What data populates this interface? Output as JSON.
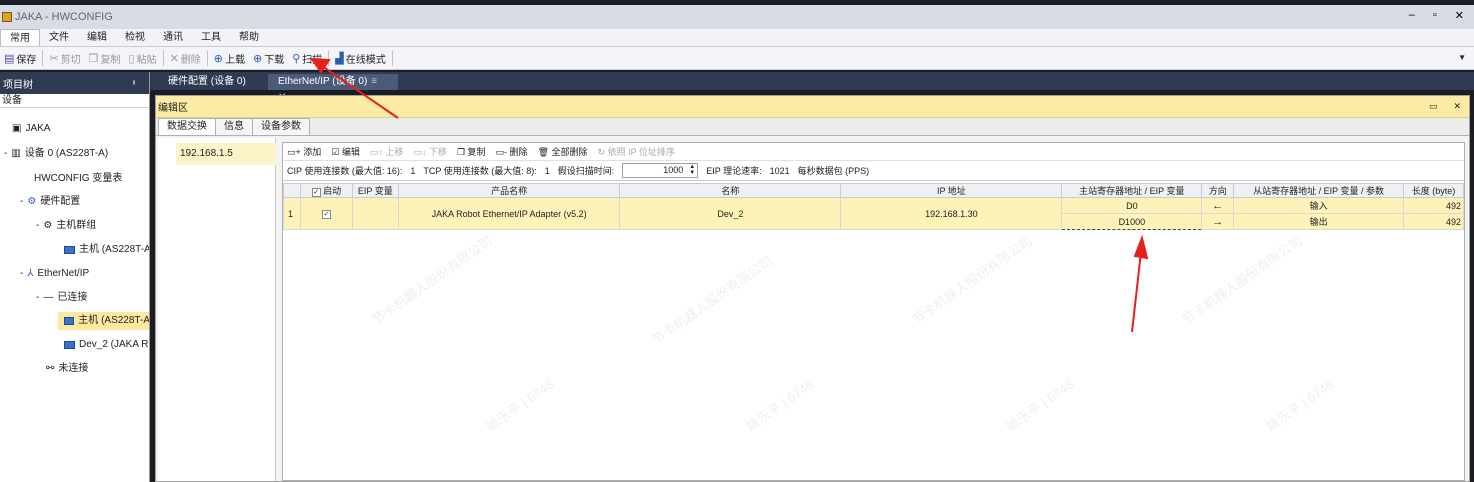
{
  "window": {
    "title": "JAKA - HWCONFIG",
    "minimize": "‒",
    "restore": "▫",
    "close": "✕"
  },
  "menu": {
    "items": [
      {
        "label": "常用"
      },
      {
        "label": "文件"
      },
      {
        "label": "编辑"
      },
      {
        "label": "检视"
      },
      {
        "label": "通讯"
      },
      {
        "label": "工具"
      },
      {
        "label": "帮助"
      }
    ]
  },
  "toolbar": {
    "save": "保存",
    "cut": "剪切",
    "copy": "复制",
    "paste": "粘贴",
    "delete": "删除",
    "upload": "上载",
    "download": "下载",
    "scan": "扫描",
    "online": "在线模式"
  },
  "left_panel": {
    "title": "项目树",
    "pin": "ᵼ",
    "subheader": "设备",
    "tree": [
      {
        "label": "JAKA"
      },
      {
        "label": "设备 0 (AS228T-A)"
      },
      {
        "label": "HWCONFIG 变量表"
      },
      {
        "label": "硬件配置"
      },
      {
        "label": "主机群组"
      },
      {
        "label": "主机 (AS228T-A"
      },
      {
        "label": "EtherNet/IP"
      },
      {
        "label": "已连接"
      },
      {
        "label": "主机 (AS228T-A"
      },
      {
        "label": "Dev_2 (JAKA R"
      },
      {
        "label": "未连接"
      }
    ]
  },
  "doc_tabs": [
    {
      "label": "硬件配置 (设备 0)"
    },
    {
      "label": "EtherNet/IP (设备 0)",
      "icons": "≡ ✕"
    }
  ],
  "editor": {
    "title": "编辑区",
    "min": "▭",
    "close": "✕",
    "tabs": [
      {
        "label": "数据交换"
      },
      {
        "label": "信息"
      },
      {
        "label": "设备参数"
      }
    ],
    "ip_list": [
      "192.168.1.5"
    ],
    "actions": {
      "add": "添加",
      "edit": "编辑",
      "move_up": "上移",
      "move_down": "下移",
      "copy": "复制",
      "delete": "删除",
      "delete_all": "全部删除",
      "sort_by_ip": "依照 IP 位址排序"
    },
    "info": {
      "cip_label": "CIP 使用连接数 (最大值: 16):",
      "cip_value": "1",
      "tcp_label": "TCP 使用连接数 (最大值: 8):",
      "tcp_value": "1",
      "scan_label": "假设扫描时间:",
      "scan_value": "1000",
      "rate_label": "EIP 理论速率:",
      "rate_value": "1021",
      "rate_unit": "每秒数据包 (PPS)"
    },
    "table": {
      "headers": [
        "",
        "启动",
        "EIP 变量",
        "产品名称",
        "名称",
        "IP 地址",
        "主站寄存器地址 / EIP 变量",
        "方向",
        "从站寄存器地址 / EIP 变量 / 参数",
        "长度 (byte)"
      ],
      "row": {
        "index": "1",
        "product": "JAKA Robot Ethernet/IP Adapter (v5.2)",
        "name": "Dev_2",
        "ip": "192.168.1.30",
        "sub": [
          {
            "master": "D0",
            "dir": "←",
            "slave": "输入",
            "length": "492"
          },
          {
            "master": "D1000",
            "dir": "→",
            "slave": "输出",
            "length": "492"
          }
        ]
      }
    }
  },
  "watermark": "节卡机器人股份有限公司",
  "watermark_id": "姚乐平 | 6748",
  "colors": {
    "title_bar": "#d8dce6",
    "panel_header": "#2f3b52",
    "editor_header": "#fbeba4",
    "row_highlight": "#fdf3b8",
    "arrow": "#e8201c"
  }
}
